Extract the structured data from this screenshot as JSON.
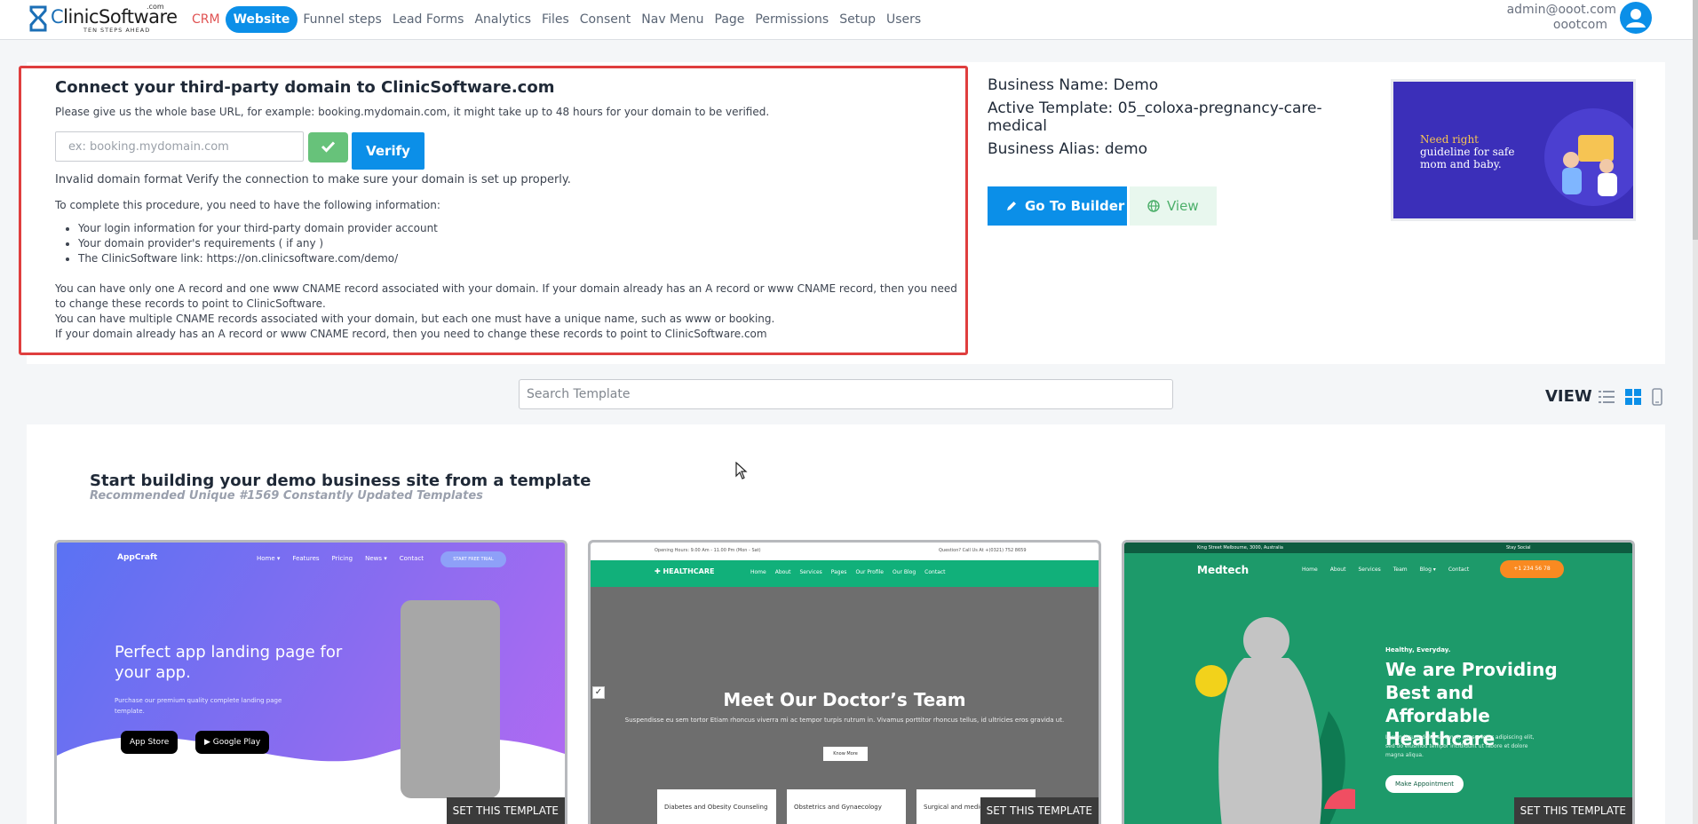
{
  "brand": {
    "name_c": "C",
    "name_rest": "linicSoftware",
    "dotcom": ".com",
    "tagline": "TEN STEPS AHEAD"
  },
  "nav": {
    "items": [
      {
        "label": "CRM"
      },
      {
        "label": "Website"
      },
      {
        "label": "Funnel steps"
      },
      {
        "label": "Lead Forms"
      },
      {
        "label": "Analytics"
      },
      {
        "label": "Files"
      },
      {
        "label": "Consent"
      },
      {
        "label": "Nav Menu"
      },
      {
        "label": "Page"
      },
      {
        "label": "Permissions"
      },
      {
        "label": "Setup"
      },
      {
        "label": "Users"
      }
    ],
    "active": "Website"
  },
  "user": {
    "email": "admin@ooot.com",
    "org": "oootcom"
  },
  "connect": {
    "title": "Connect your third-party domain to ClinicSoftware.com",
    "hint": "Please give us the whole base URL, for example: booking.mydomain.com, it might take up to 48 hours for your domain to be verified.",
    "input_placeholder": "ex: booking.mydomain.com",
    "verify_label": "Verify",
    "status": "Invalid domain format Verify the connection to make sure your domain is set up properly.",
    "intro": "To complete this procedure, you need to have the following information:",
    "requirements": [
      "Your login information for your third-party domain provider account",
      "Your domain provider's requirements ( if any )",
      "The ClinicSoftware link: https://on.clinicsoftware.com/demo/"
    ],
    "notes": [
      "You can have only one A record and one www CNAME record associated with your domain. If your domain already has an A record or www CNAME record, then you need to change these records to point to ClinicSoftware.",
      "You can have multiple CNAME records associated with your domain, but each one must have a unique name, such as www or booking.",
      "If your domain already has an A record or www CNAME record, then you need to change these records to point to ClinicSoftware.com"
    ]
  },
  "business": {
    "name_line": "Business Name: Demo",
    "template_line": "Active Template: 05_coloxa-pregnancy-care-medical",
    "alias_line": "Business Alias: demo",
    "builder_label": "Go To Builder",
    "view_label": "View"
  },
  "active_template_preview": {
    "headline_1": "Need right",
    "headline_2": "guideline for safe mom and baby."
  },
  "search": {
    "placeholder": "Search Template"
  },
  "view_toggle": {
    "label": "VIEW"
  },
  "templates": {
    "title": "Start building your demo business site from a template",
    "subtitle": "Recommended Unique #1569 Constantly Updated Templates",
    "set_label": "SET THIS TEMPLATE",
    "cards": [
      {
        "logo": "AppCraft",
        "nav": [
          "Home ▾",
          "Features",
          "Pricing",
          "News ▾",
          "Contact"
        ],
        "cta": "START FREE TRIAL",
        "headline": "Perfect app landing page for your app.",
        "text": "Purchase our premium quality complete landing page template.",
        "badge_1": " App Store",
        "badge_2": "▶ Google Play"
      },
      {
        "topbar_left": "Opening Hours: 9.00 Am - 11.00 Pm (Mon - Sat)",
        "topbar_right": "Question? Call Us At +(0321) 752 8659",
        "logo": "✚ HEALTHCARE",
        "nav": [
          "Home",
          "About",
          "Services",
          "Pages",
          "Our Profile",
          "Our Blog",
          "Contact"
        ],
        "headline": "Meet Our Doctor’s Team",
        "text": "Suspendisse eu sem tortor Etiam rhoncus viverra mi ac tempor turpis rutrum in. Vivamus porttitor rhoncus tellus, id ultricies eros gravida ut.",
        "button": "Know More",
        "boxes": [
          "Diabetes and Obesity Counseling",
          "Obstetrics and Gynaecology",
          "Surgical and medical Oncology"
        ]
      },
      {
        "topbar_left": "King Street Melbourne, 3000, Australia",
        "topbar_right": "Stay Social",
        "logo": "Medtech",
        "nav": [
          "Home",
          "About",
          "Services",
          "Team",
          "Blog ▾",
          "Contact"
        ],
        "cta": "+1 234 56 78",
        "kicker": "Healthy, Everyday.",
        "headline": "We are Providing Best and Affordable Healthcare",
        "text": "Lorem ipsum dolor sit amet, consectetur adipiscing elit, sed do eiusmod tempor incididunt ut labore et dolore magna aliqua.",
        "button": "Make Appointment"
      }
    ]
  }
}
